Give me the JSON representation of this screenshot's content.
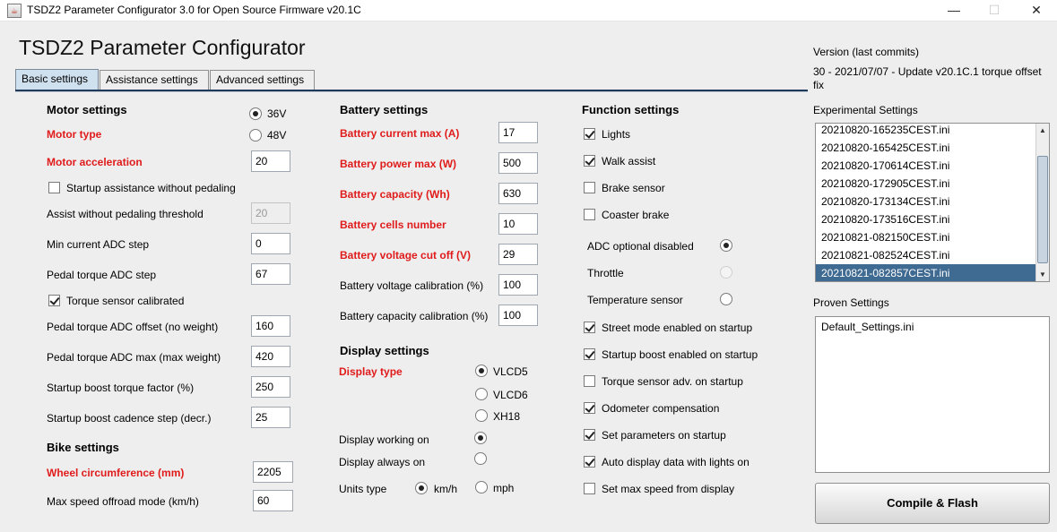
{
  "window": {
    "title": "TSDZ2 Parameter Configurator 3.0 for Open Source Firmware v20.1C",
    "minimize": "—",
    "maximize": "☐",
    "close": "✕",
    "app_icon": "java-icon"
  },
  "app_title": "TSDZ2 Parameter Configurator",
  "tabs": [
    "Basic settings",
    "Assistance settings",
    "Advanced settings"
  ],
  "motor": {
    "section": "Motor settings",
    "voltage_36": "36V",
    "voltage_48": "48V",
    "motor_type": "Motor type",
    "motor_acceleration": "Motor acceleration",
    "motor_acceleration_value": "20",
    "startup_assist": "Startup assistance without pedaling",
    "assist_threshold": "Assist without pedaling threshold",
    "assist_threshold_value": "20",
    "min_current": "Min current ADC step",
    "min_current_value": "0",
    "pedal_torque_step": "Pedal torque ADC step",
    "pedal_torque_step_value": "67",
    "torque_calibrated": "Torque sensor calibrated",
    "torque_offset": "Pedal torque ADC offset (no weight)",
    "torque_offset_value": "160",
    "torque_max": "Pedal torque ADC max (max weight)",
    "torque_max_value": "420",
    "boost_torque": "Startup boost torque factor (%)",
    "boost_torque_value": "250",
    "boost_cadence": "Startup boost cadence step (decr.)",
    "boost_cadence_value": "25"
  },
  "bike": {
    "section": "Bike settings",
    "wheel": "Wheel circumference (mm)",
    "wheel_value": "2205",
    "max_speed": "Max speed offroad mode (km/h)",
    "max_speed_value": "60"
  },
  "battery": {
    "section": "Battery settings",
    "current_max": "Battery current max (A)",
    "current_max_value": "17",
    "power_max": "Battery power max (W)",
    "power_max_value": "500",
    "capacity": "Battery capacity (Wh)",
    "capacity_value": "630",
    "cells": "Battery cells number",
    "cells_value": "10",
    "cutoff": "Battery voltage cut off (V)",
    "cutoff_value": "29",
    "voltage_cal": "Battery voltage calibration (%)",
    "voltage_cal_value": "100",
    "capacity_cal": "Battery capacity calibration (%)",
    "capacity_cal_value": "100"
  },
  "display": {
    "section": "Display settings",
    "type": "Display type",
    "vlcd5": "VLCD5",
    "vlcd6": "VLCD6",
    "xh18": "XH18",
    "working_on": "Display working on",
    "always_on": "Display always on",
    "units": "Units type",
    "kmh": "km/h",
    "mph": "mph"
  },
  "function": {
    "section": "Function settings",
    "lights": "Lights",
    "walk_assist": "Walk assist",
    "brake_sensor": "Brake sensor",
    "coaster_brake": "Coaster brake",
    "adc_disabled": "ADC optional disabled",
    "throttle": "Throttle",
    "temp_sensor": "Temperature sensor",
    "street_mode": "Street mode enabled on startup",
    "startup_boost": "Startup boost enabled  on startup",
    "torque_adv": "Torque sensor adv. on startup",
    "odometer": "Odometer compensation",
    "set_params": "Set parameters on startup",
    "auto_display": "Auto display data with lights on",
    "set_max_speed": "Set max speed from display"
  },
  "right": {
    "version_label": "Version (last commits)",
    "version_text": "30 - 2021/07/07 - Update v20.1C.1 torque offset fix",
    "experimental_label": "Experimental Settings",
    "experimental_items": [
      "20210820-165235CEST.ini",
      "20210820-165425CEST.ini",
      "20210820-170614CEST.ini",
      "20210820-172905CEST.ini",
      "20210820-173134CEST.ini",
      "20210820-173516CEST.ini",
      "20210821-082150CEST.ini",
      "20210821-082524CEST.ini",
      "20210821-082857CEST.ini"
    ],
    "proven_label": "Proven Settings",
    "proven_items": [
      "Default_Settings.ini"
    ],
    "compile_button": "Compile & Flash",
    "scroll_up": "▲",
    "scroll_down": "▼"
  },
  "colors": {
    "required_label": "#e01b1b",
    "selected_row": "#3f6a92",
    "active_tab": "#cfe0ef"
  }
}
